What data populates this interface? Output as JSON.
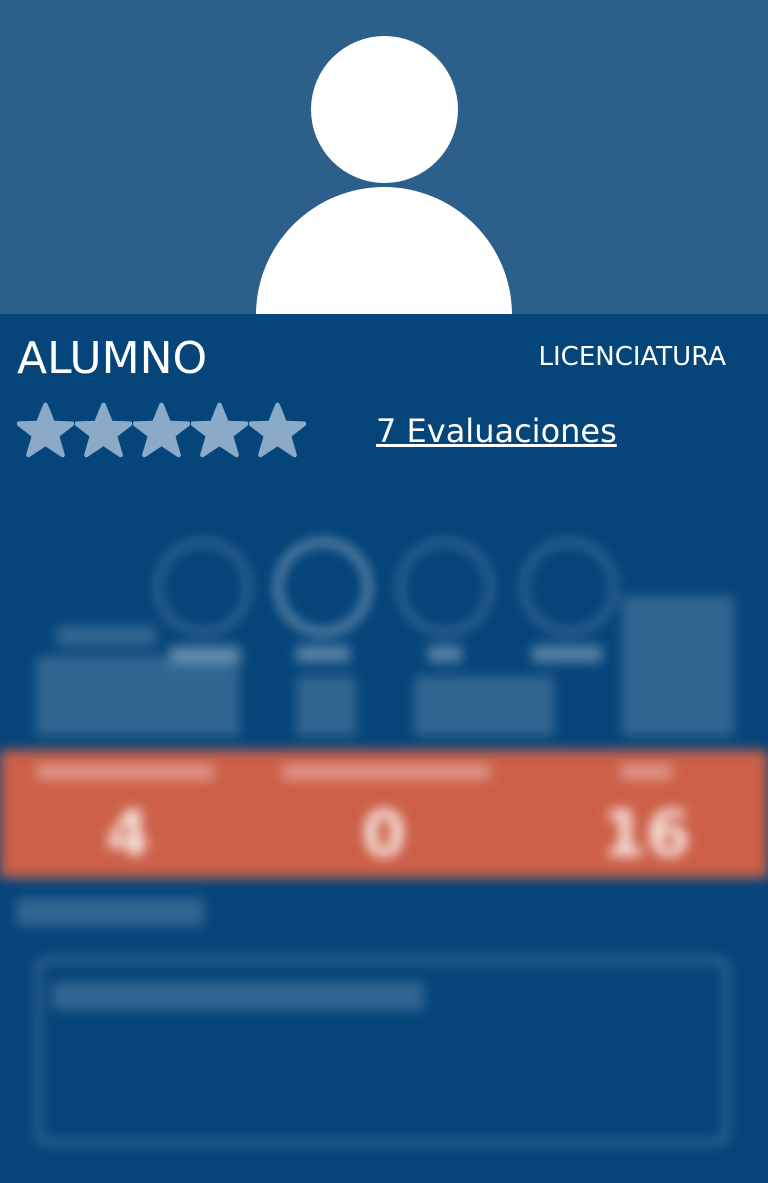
{
  "profile": {
    "name": "ALUMNO",
    "level": "LICENCIATURA",
    "rating_stars_filled": 0,
    "rating_stars_total": 5,
    "evaluations_link": "7 Evaluaciones"
  },
  "colors": {
    "header_bg": "#2c5f8a",
    "page_bg": "#05457a",
    "star_fill": "#8aaac8",
    "stats_bar": "#cc5f47"
  },
  "icons": [
    "avatar-icon",
    "star-icon",
    "music-icon",
    "swim-icon",
    "network-icon",
    "book-icon"
  ],
  "stats": {
    "values": [
      "4",
      "0",
      "16"
    ]
  }
}
